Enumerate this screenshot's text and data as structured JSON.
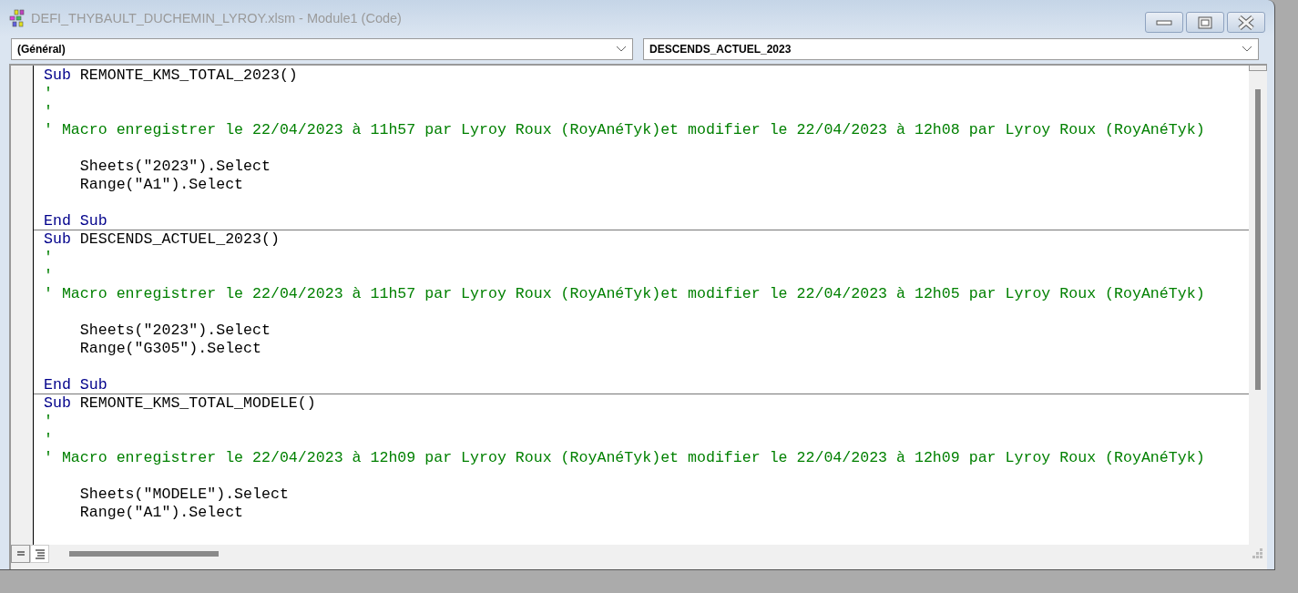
{
  "window": {
    "title": "DEFI_THYBAULT_DUCHEMIN_LYROY.xlsm - Module1 (Code)"
  },
  "object_dropdown": {
    "value": "(Général)"
  },
  "procedure_dropdown": {
    "value": "DESCENDS_ACTUEL_2023"
  },
  "procedures": [
    {
      "lines": [
        {
          "kind": "code",
          "segments": [
            {
              "text": "Sub",
              "kind": "keyword"
            },
            {
              "text": " REMONTE_KMS_TOTAL_2023()",
              "kind": "plain"
            }
          ]
        },
        {
          "kind": "code",
          "segments": [
            {
              "text": "'",
              "kind": "comment"
            }
          ]
        },
        {
          "kind": "code",
          "segments": [
            {
              "text": "'",
              "kind": "comment"
            }
          ]
        },
        {
          "kind": "code",
          "segments": [
            {
              "text": "' Macro enregistrer le 22/04/2023 à 11h57 par Lyroy Roux (RoyAnéTyk)et modifier le 22/04/2023 à 12h08 par Lyroy Roux (RoyAnéTyk)",
              "kind": "comment"
            }
          ]
        },
        {
          "kind": "blank"
        },
        {
          "kind": "code",
          "segments": [
            {
              "text": "    Sheets(\"2023\").Select",
              "kind": "plain"
            }
          ]
        },
        {
          "kind": "code",
          "segments": [
            {
              "text": "    Range(\"A1\").Select",
              "kind": "plain"
            }
          ]
        },
        {
          "kind": "blank"
        },
        {
          "kind": "code",
          "segments": [
            {
              "text": "End Sub",
              "kind": "keyword"
            }
          ]
        }
      ]
    },
    {
      "lines": [
        {
          "kind": "code",
          "segments": [
            {
              "text": "Sub",
              "kind": "keyword"
            },
            {
              "text": " DESCENDS_ACTUEL_2023()",
              "kind": "plain"
            }
          ]
        },
        {
          "kind": "code",
          "segments": [
            {
              "text": "'",
              "kind": "comment"
            }
          ]
        },
        {
          "kind": "code",
          "segments": [
            {
              "text": "'",
              "kind": "comment"
            }
          ]
        },
        {
          "kind": "code",
          "segments": [
            {
              "text": "' Macro enregistrer le 22/04/2023 à 11h57 par Lyroy Roux (RoyAnéTyk)et modifier le 22/04/2023 à 12h05 par Lyroy Roux (RoyAnéTyk)",
              "kind": "comment"
            }
          ]
        },
        {
          "kind": "blank"
        },
        {
          "kind": "code",
          "segments": [
            {
              "text": "    Sheets(\"2023\").Select",
              "kind": "plain"
            }
          ]
        },
        {
          "kind": "code",
          "segments": [
            {
              "text": "    Range(\"G305\").Select",
              "kind": "plain"
            }
          ]
        },
        {
          "kind": "blank"
        },
        {
          "kind": "code",
          "segments": [
            {
              "text": "End Sub",
              "kind": "keyword"
            }
          ]
        }
      ]
    },
    {
      "lines": [
        {
          "kind": "code",
          "segments": [
            {
              "text": "Sub",
              "kind": "keyword"
            },
            {
              "text": " REMONTE_KMS_TOTAL_MODELE()",
              "kind": "plain"
            }
          ]
        },
        {
          "kind": "code",
          "segments": [
            {
              "text": "'",
              "kind": "comment"
            }
          ]
        },
        {
          "kind": "code",
          "segments": [
            {
              "text": "'",
              "kind": "comment"
            }
          ]
        },
        {
          "kind": "code",
          "segments": [
            {
              "text": "' Macro enregistrer le 22/04/2023 à 12h09 par Lyroy Roux (RoyAnéTyk)et modifier le 22/04/2023 à 12h09 par Lyroy Roux (RoyAnéTyk)",
              "kind": "comment"
            }
          ]
        },
        {
          "kind": "blank"
        },
        {
          "kind": "code",
          "segments": [
            {
              "text": "    Sheets(\"MODELE\").Select",
              "kind": "plain"
            }
          ]
        },
        {
          "kind": "code",
          "segments": [
            {
              "text": "    Range(\"A1\").Select",
              "kind": "plain"
            }
          ]
        },
        {
          "kind": "blank"
        }
      ]
    }
  ],
  "view_buttons": [
    {
      "kind": "procedure",
      "selected": false
    },
    {
      "kind": "module",
      "selected": true
    }
  ]
}
